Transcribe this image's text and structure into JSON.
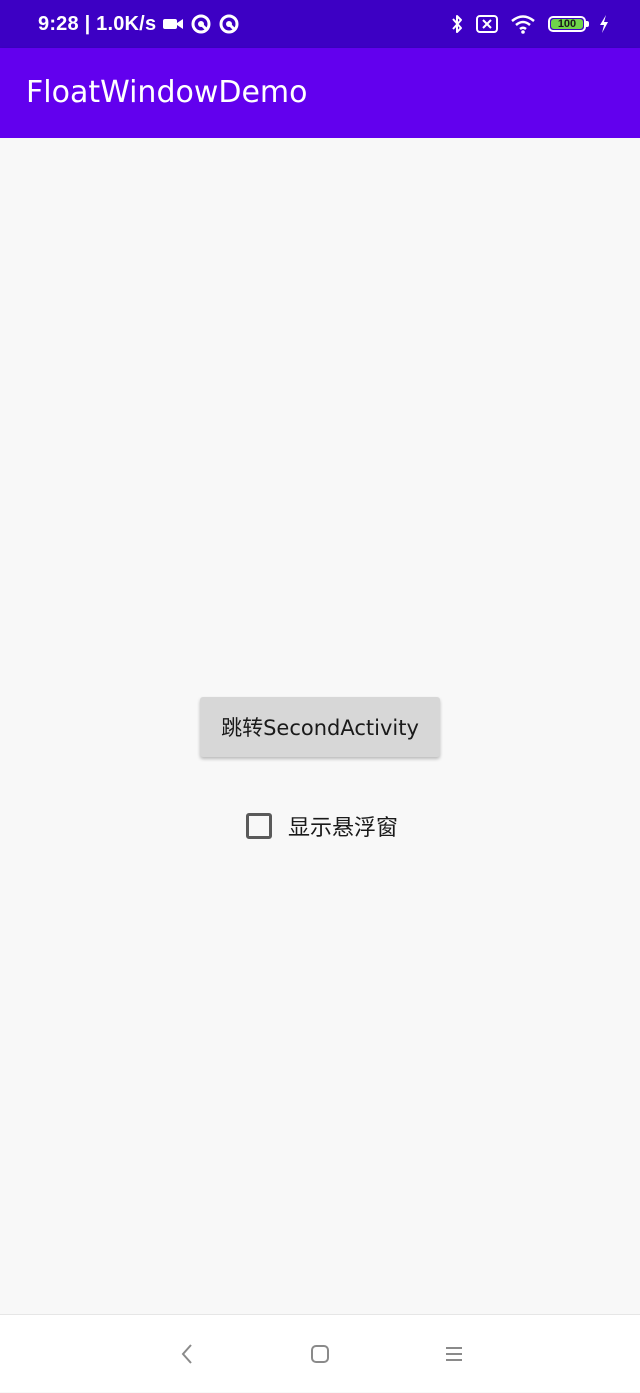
{
  "status_bar": {
    "time_speed": "9:28 | 1.0K/s",
    "left_icons": [
      "video-camera-icon",
      "data-saver-icon",
      "data-saver-icon"
    ],
    "right_icons": [
      "bluetooth-icon",
      "no-sim-icon",
      "wifi-icon",
      "battery-icon",
      "charging-bolt-icon"
    ],
    "battery_level": "100",
    "battery_color": "#6fd34a",
    "background": "#3d00c4"
  },
  "app_bar": {
    "title": "FloatWindowDemo",
    "background": "#6200ee"
  },
  "main": {
    "jump_button_label": "跳转SecondActivity",
    "float_window_checkbox": {
      "label": "显示悬浮窗",
      "checked": false
    }
  },
  "nav_bar": {
    "buttons": [
      "back-icon",
      "home-icon",
      "recents-icon"
    ]
  }
}
